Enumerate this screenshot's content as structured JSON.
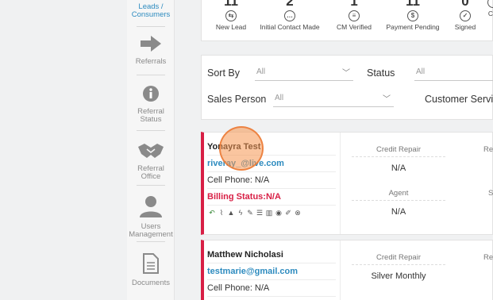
{
  "sidebar": {
    "items": [
      {
        "label": "Leads / Consumers",
        "icon": "users-icon",
        "active": true
      },
      {
        "label": "Referrals",
        "icon": "arrow-right-icon"
      },
      {
        "label": "Referral Status",
        "icon": "info-icon"
      },
      {
        "label": "Referral Office",
        "icon": "handshake-icon"
      },
      {
        "label": "Users Management",
        "icon": "user-icon"
      },
      {
        "label": "Documents",
        "icon": "document-icon"
      }
    ],
    "labels": {
      "leads_1": "Leads /",
      "leads_2": "Consumers",
      "referrals": "Referrals",
      "status_1": "Referral",
      "status_2": "Status",
      "office_1": "Referral",
      "office_2": "Office",
      "users_1": "Users",
      "users_2": "Management",
      "documents": "Documents"
    }
  },
  "stats": [
    {
      "count": "11",
      "label": "New Lead",
      "icon": "lead-icon"
    },
    {
      "count": "2",
      "label": "Initial Contact Made",
      "icon": "chat-icon"
    },
    {
      "count": "1",
      "label": "CM Verified",
      "icon": "verified-icon"
    },
    {
      "count": "11",
      "label": "Payment Pending",
      "icon": "dollar-icon"
    },
    {
      "count": "0",
      "label": "Signed",
      "icon": "signed-icon"
    },
    {
      "count": "",
      "label": "C",
      "icon": "partial-icon"
    }
  ],
  "filters": {
    "sort_by_label": "Sort By",
    "sort_by_value": "All",
    "status_label": "Status",
    "status_value": "All",
    "sales_person_label": "Sales Person",
    "sales_person_value": "All",
    "customer_service_label": "Customer Servi"
  },
  "cards": [
    {
      "name": "Yonayra Test",
      "email": "riveray_@live.com",
      "phone": "Cell Phone: N/A",
      "billing": "Billing Status:N/A",
      "credit_repair_label": "Credit Repair",
      "credit_repair_value": "N/A",
      "agent_label": "Agent",
      "agent_value": "N/A",
      "col3_label": "Re",
      "col3b_label": "S"
    },
    {
      "name": "Matthew Nicholasi",
      "email": "testmarie@gmail.com",
      "phone": "Cell Phone: N/A",
      "credit_repair_label": "Credit Repair",
      "credit_repair_value": "Silver Monthly",
      "col3_label": "Re"
    }
  ],
  "actions": [
    "reply-icon",
    "paperclip-icon",
    "warning-icon",
    "bolt-icon",
    "edit-icon",
    "list-icon",
    "chart-icon",
    "eye-icon",
    "pencil-icon",
    "close-circle-icon"
  ]
}
